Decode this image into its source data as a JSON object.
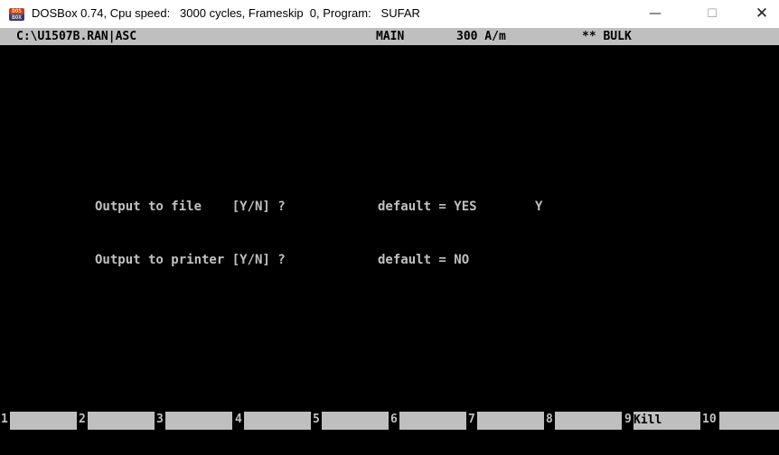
{
  "window": {
    "title": "DOSBox 0.74, Cpu speed:   3000 cycles, Frameskip  0, Program:   SUFAR",
    "icon_text": "DOS BOX",
    "minimize": "—",
    "maximize": "☐",
    "close": "✕"
  },
  "statusbar": {
    "path": "C:\\U1507B.RAN|ASC",
    "mode": "MAIN",
    "field": "300 A/m",
    "measurement": "** BULK"
  },
  "prompts": {
    "file": {
      "question": "Output to file    [Y/N] ?",
      "default": "default = YES",
      "answer": "Y"
    },
    "printer": {
      "question": "Output to printer [Y/N] ?",
      "default": "default = NO",
      "answer": ""
    }
  },
  "fkeys": [
    {
      "num": "1",
      "label": ""
    },
    {
      "num": "2",
      "label": ""
    },
    {
      "num": "3",
      "label": ""
    },
    {
      "num": "4",
      "label": ""
    },
    {
      "num": "5",
      "label": ""
    },
    {
      "num": "6",
      "label": ""
    },
    {
      "num": "7",
      "label": ""
    },
    {
      "num": "8",
      "label": ""
    },
    {
      "num": "9",
      "label": "Kill"
    },
    {
      "num": "10",
      "label": ""
    }
  ]
}
